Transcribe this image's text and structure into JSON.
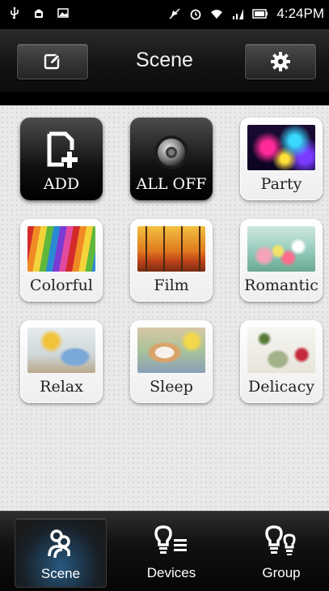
{
  "status_bar": {
    "time": "4:24PM",
    "icons": [
      "usb-icon",
      "android-debug-icon",
      "image-notification-icon",
      "mute-icon",
      "alarm-icon",
      "wifi-icon",
      "signal-icon",
      "battery-icon"
    ]
  },
  "header": {
    "title": "Scene",
    "edit_icon": "edit-icon",
    "settings_icon": "gear-icon"
  },
  "scenes": [
    {
      "label": "ADD",
      "style": "dark",
      "icon": "add-document-icon"
    },
    {
      "label": "ALL OFF",
      "style": "dark",
      "icon": "power-knob-icon"
    },
    {
      "label": "Party",
      "style": "light",
      "image": "party-image"
    },
    {
      "label": "Colorful",
      "style": "light",
      "image": "colored-pencils-image"
    },
    {
      "label": "Film",
      "style": "light",
      "image": "autumn-forest-image"
    },
    {
      "label": "Romantic",
      "style": "light",
      "image": "flowers-image"
    },
    {
      "label": "Relax",
      "style": "light",
      "image": "teacup-image"
    },
    {
      "label": "Sleep",
      "style": "light",
      "image": "puppy-image"
    },
    {
      "label": "Delicacy",
      "style": "light",
      "image": "dessert-image"
    }
  ],
  "bottom_nav": [
    {
      "label": "Scene",
      "icon": "scene-icon",
      "active": true
    },
    {
      "label": "Devices",
      "icon": "devices-bulb-icon",
      "active": false
    },
    {
      "label": "Group",
      "icon": "group-bulbs-icon",
      "active": false
    }
  ],
  "colors": {
    "header_bg": "#1a1a1a",
    "main_bg": "#e9e9e9",
    "active_nav_glow": "#328cd2"
  }
}
